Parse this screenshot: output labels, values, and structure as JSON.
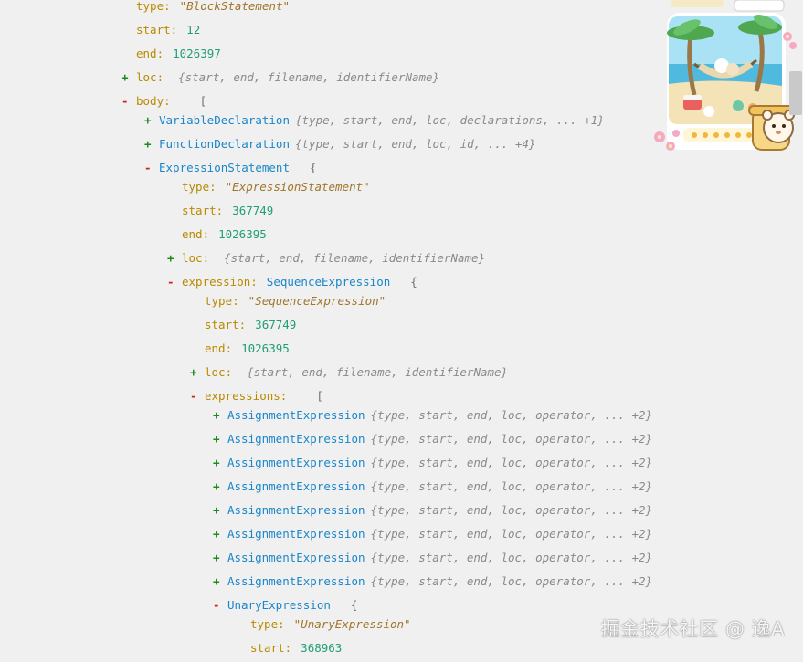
{
  "tree": {
    "rows": [
      {
        "toggle": "",
        "key": "type",
        "value": "\"BlockStatement\"",
        "kind": "str"
      },
      {
        "toggle": "",
        "key": "start",
        "value": "12",
        "kind": "num"
      },
      {
        "toggle": "",
        "key": "end",
        "value": "1026397",
        "kind": "num"
      },
      {
        "toggle": "+",
        "key": "loc",
        "summary": "{start, end, filename, identifierName}",
        "kind": "collapsed"
      },
      {
        "toggle": "-",
        "key": "body",
        "bracket": "[",
        "kind": "open"
      },
      {
        "toggle": "+",
        "node": "VariableDeclaration",
        "summary": "{type, start, end, loc, declarations, ... +1}",
        "kind": "nodesummary"
      },
      {
        "toggle": "+",
        "node": "FunctionDeclaration",
        "summary": "{type, start, end, loc, id, ... +4}",
        "kind": "nodesummary"
      },
      {
        "toggle": "-",
        "node": "ExpressionStatement",
        "bracket": "{",
        "kind": "nodeopen"
      },
      {
        "toggle": "",
        "key": "type",
        "value": "\"ExpressionStatement\"",
        "kind": "str"
      },
      {
        "toggle": "",
        "key": "start",
        "value": "367749",
        "kind": "num"
      },
      {
        "toggle": "",
        "key": "end",
        "value": "1026395",
        "kind": "num"
      },
      {
        "toggle": "+",
        "key": "loc",
        "summary": "{start, end, filename, identifierName}",
        "kind": "collapsed"
      },
      {
        "toggle": "-",
        "key": "expression",
        "node": "SequenceExpression",
        "bracket": "{",
        "kind": "keynodeopen"
      },
      {
        "toggle": "",
        "key": "type",
        "value": "\"SequenceExpression\"",
        "kind": "str"
      },
      {
        "toggle": "",
        "key": "start",
        "value": "367749",
        "kind": "num"
      },
      {
        "toggle": "",
        "key": "end",
        "value": "1026395",
        "kind": "num"
      },
      {
        "toggle": "+",
        "key": "loc",
        "summary": "{start, end, filename, identifierName}",
        "kind": "collapsed"
      },
      {
        "toggle": "-",
        "key": "expressions",
        "bracket": "[",
        "kind": "open"
      },
      {
        "toggle": "+",
        "node": "AssignmentExpression",
        "summary": "{type, start, end, loc, operator, ... +2}",
        "kind": "nodesummary"
      },
      {
        "toggle": "+",
        "node": "AssignmentExpression",
        "summary": "{type, start, end, loc, operator, ... +2}",
        "kind": "nodesummary"
      },
      {
        "toggle": "+",
        "node": "AssignmentExpression",
        "summary": "{type, start, end, loc, operator, ... +2}",
        "kind": "nodesummary"
      },
      {
        "toggle": "+",
        "node": "AssignmentExpression",
        "summary": "{type, start, end, loc, operator, ... +2}",
        "kind": "nodesummary"
      },
      {
        "toggle": "+",
        "node": "AssignmentExpression",
        "summary": "{type, start, end, loc, operator, ... +2}",
        "kind": "nodesummary"
      },
      {
        "toggle": "+",
        "node": "AssignmentExpression",
        "summary": "{type, start, end, loc, operator, ... +2}",
        "kind": "nodesummary"
      },
      {
        "toggle": "+",
        "node": "AssignmentExpression",
        "summary": "{type, start, end, loc, operator, ... +2}",
        "kind": "nodesummary"
      },
      {
        "toggle": "+",
        "node": "AssignmentExpression",
        "summary": "{type, start, end, loc, operator, ... +2}",
        "kind": "nodesummary"
      },
      {
        "toggle": "-",
        "node": "UnaryExpression",
        "bracket": "{",
        "kind": "nodeopen"
      },
      {
        "toggle": "",
        "key": "type",
        "value": "\"UnaryExpression\"",
        "kind": "str"
      },
      {
        "toggle": "",
        "key": "start",
        "value": "368963",
        "kind": "num"
      }
    ]
  },
  "watermark": "掘金技术社区 @ 逸A",
  "decoration": {
    "mascot_icon": "beach-hammock-sticker-icon"
  }
}
